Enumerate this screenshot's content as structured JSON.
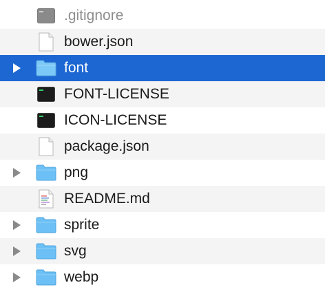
{
  "window": {
    "title": ""
  },
  "files": [
    {
      "name": ".gitignore",
      "kind": "terminal-doc-icon",
      "expandable": false,
      "dimmed": true,
      "selected": false
    },
    {
      "name": "bower.json",
      "kind": "document-icon",
      "expandable": false,
      "dimmed": false,
      "selected": false
    },
    {
      "name": "font",
      "kind": "folder-icon",
      "expandable": true,
      "dimmed": false,
      "selected": true
    },
    {
      "name": "FONT-LICENSE",
      "kind": "terminal-doc-icon",
      "expandable": false,
      "dimmed": false,
      "selected": false
    },
    {
      "name": "ICON-LICENSE",
      "kind": "terminal-doc-icon",
      "expandable": false,
      "dimmed": false,
      "selected": false
    },
    {
      "name": "package.json",
      "kind": "document-icon",
      "expandable": false,
      "dimmed": false,
      "selected": false
    },
    {
      "name": "png",
      "kind": "folder-icon",
      "expandable": true,
      "dimmed": false,
      "selected": false
    },
    {
      "name": "README.md",
      "kind": "markdown-doc-icon",
      "expandable": false,
      "dimmed": false,
      "selected": false
    },
    {
      "name": "sprite",
      "kind": "folder-icon",
      "expandable": true,
      "dimmed": false,
      "selected": false
    },
    {
      "name": "svg",
      "kind": "folder-icon",
      "expandable": true,
      "dimmed": false,
      "selected": false
    },
    {
      "name": "webp",
      "kind": "folder-icon",
      "expandable": true,
      "dimmed": false,
      "selected": false
    }
  ],
  "colors": {
    "selection": "#1d67d3",
    "stripe": "#f4f4f4",
    "folder": "#6cc0f5",
    "text": "#1a1a1a",
    "dimmed_text": "#8e8e8e"
  }
}
